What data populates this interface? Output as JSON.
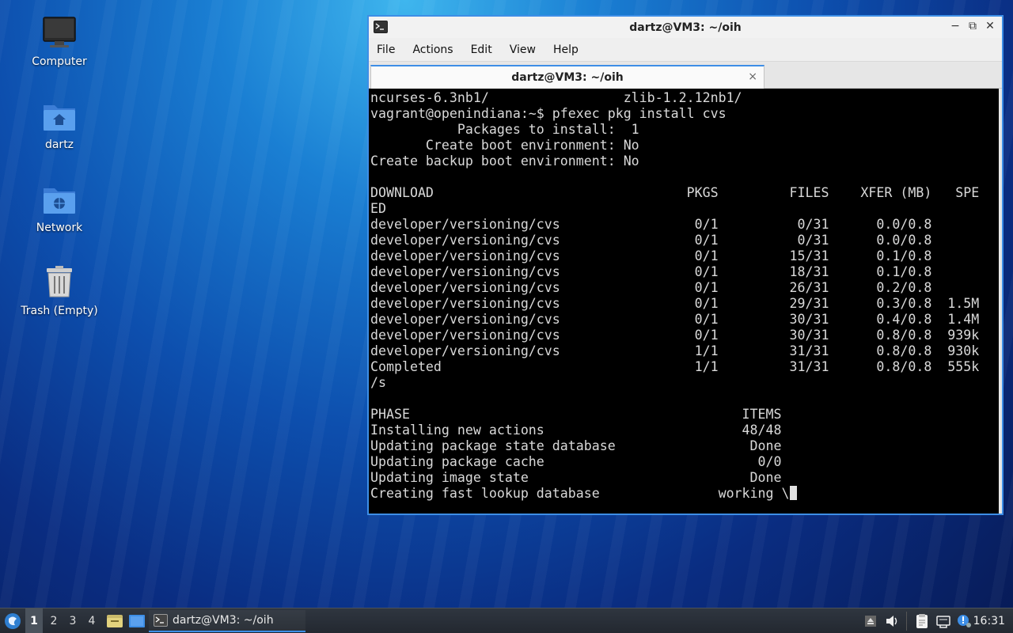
{
  "desktop": {
    "icons": [
      {
        "label": "Computer",
        "icon": "monitor-icon"
      },
      {
        "label": "dartz",
        "icon": "home-folder-icon"
      },
      {
        "label": "Network",
        "icon": "network-folder-icon"
      },
      {
        "label": "Trash (Empty)",
        "icon": "trash-icon"
      }
    ]
  },
  "window": {
    "title": "dartz@VM3: ~/oih",
    "controls": {
      "minimize": "−",
      "restore": "⧉",
      "close": "✕"
    },
    "menu": [
      "File",
      "Actions",
      "Edit",
      "View",
      "Help"
    ],
    "tab": {
      "label": "dartz@VM3: ~/oih",
      "close": "×"
    },
    "terminal_lines": [
      "ncurses-6.3nb1/                 zlib-1.2.12nb1/",
      "vagrant@openindiana:~$ pfexec pkg install cvs",
      "           Packages to install:  1",
      "       Create boot environment: No",
      "Create backup boot environment: No",
      "",
      "DOWNLOAD                                PKGS         FILES    XFER (MB)   SPE",
      "ED",
      "developer/versioning/cvs                 0/1          0/31      0.0/0.8",
      "developer/versioning/cvs                 0/1          0/31      0.0/0.8",
      "developer/versioning/cvs                 0/1         15/31      0.1/0.8",
      "developer/versioning/cvs                 0/1         18/31      0.1/0.8",
      "developer/versioning/cvs                 0/1         26/31      0.2/0.8",
      "developer/versioning/cvs                 0/1         29/31      0.3/0.8  1.5M",
      "developer/versioning/cvs                 0/1         30/31      0.4/0.8  1.4M",
      "developer/versioning/cvs                 0/1         30/31      0.8/0.8  939k",
      "developer/versioning/cvs                 1/1         31/31      0.8/0.8  930k",
      "Completed                                1/1         31/31      0.8/0.8  555k",
      "/s",
      "",
      "PHASE                                          ITEMS",
      "Installing new actions                         48/48",
      "Updating package state database                 Done",
      "Updating package cache                           0/0",
      "Updating image state                            Done",
      "Creating fast lookup database               working \\"
    ]
  },
  "taskbar": {
    "workspaces": [
      "1",
      "2",
      "3",
      "4"
    ],
    "active_workspace": "1",
    "task_label": "dartz@VM3: ~/oih",
    "clock": "16:31"
  },
  "colors": {
    "accent": "#3d8ee6",
    "terminal_bg": "#000000",
    "terminal_fg": "#d9d9d9"
  }
}
